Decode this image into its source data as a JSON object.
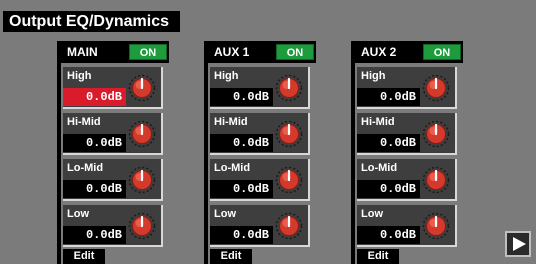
{
  "screen": {
    "title": "Output EQ/Dynamics"
  },
  "strips": [
    {
      "name": "MAIN",
      "on_label": "ON",
      "edit_label": "Edit",
      "bands": [
        {
          "label": "High",
          "value": "0.0dB",
          "selected": true
        },
        {
          "label": "Hi-Mid",
          "value": "0.0dB"
        },
        {
          "label": "Lo-Mid",
          "value": "0.0dB"
        },
        {
          "label": "Low",
          "value": "0.0dB"
        }
      ]
    },
    {
      "name": "AUX 1",
      "on_label": "ON",
      "edit_label": "Edit",
      "bands": [
        {
          "label": "High",
          "value": "0.0dB"
        },
        {
          "label": "Hi-Mid",
          "value": "0.0dB"
        },
        {
          "label": "Lo-Mid",
          "value": "0.0dB"
        },
        {
          "label": "Low",
          "value": "0.0dB"
        }
      ]
    },
    {
      "name": "AUX 2",
      "on_label": "ON",
      "edit_label": "Edit",
      "bands": [
        {
          "label": "High",
          "value": "0.0dB"
        },
        {
          "label": "Hi-Mid",
          "value": "0.0dB"
        },
        {
          "label": "Lo-Mid",
          "value": "0.0dB"
        },
        {
          "label": "Low",
          "value": "0.0dB"
        }
      ]
    }
  ],
  "next_button": {
    "icon": "play-right-icon"
  },
  "colors": {
    "background": "#7b7b7b",
    "on_green": "#1e9b3c",
    "selected_red": "#d81c2c",
    "knob_red": "#d33a2c"
  }
}
